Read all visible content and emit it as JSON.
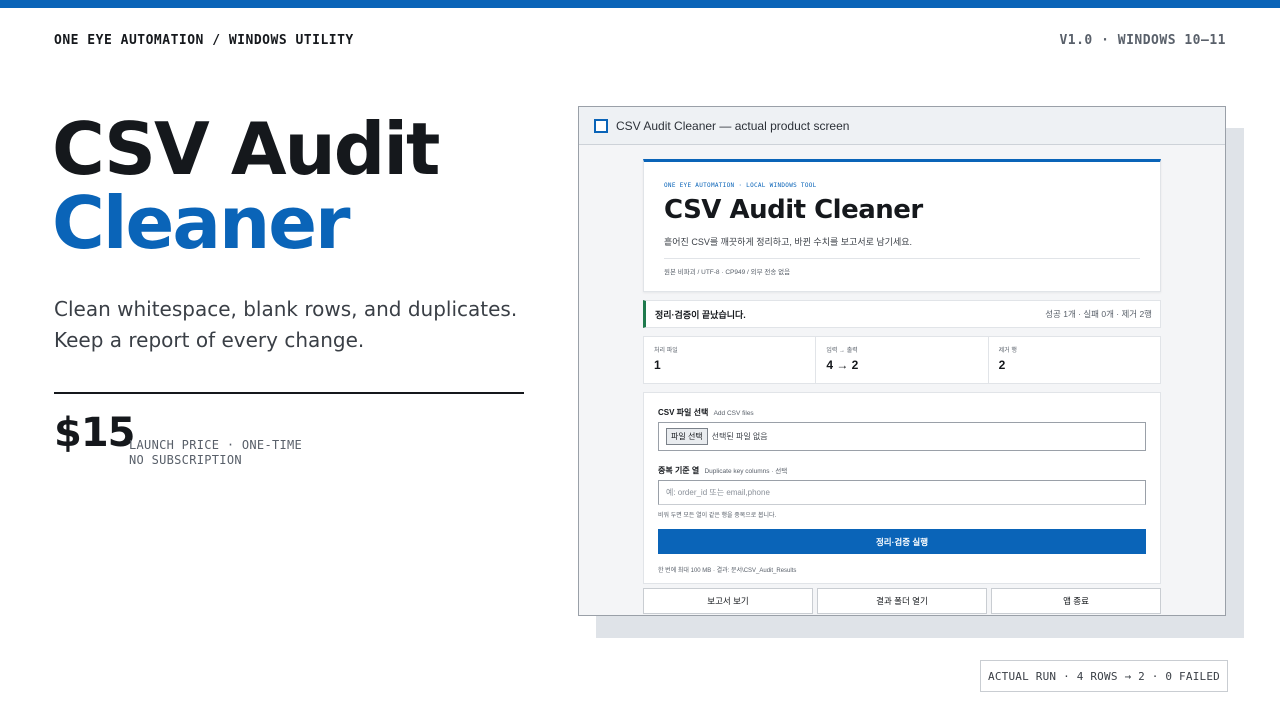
{
  "colors": {
    "accent": "#0a64b8",
    "success": "#1f7a4d",
    "text": "#15181c",
    "muted": "#59606a"
  },
  "header": {
    "left": "ONE EYE AUTOMATION / WINDOWS UTILITY",
    "right": "V1.0 · WINDOWS 10–11"
  },
  "hero": {
    "title_line1": "CSV Audit",
    "title_line2": "Cleaner",
    "subtitle": "Clean whitespace, blank rows, and duplicates. Keep a report of every change.",
    "price": "$15",
    "price_note_line1": "LAUNCH PRICE · ONE-TIME",
    "price_note_line2": "NO SUBSCRIPTION"
  },
  "window": {
    "checkbox_icon": "checkbox-icon",
    "title": "CSV Audit Cleaner — actual product screen",
    "app": {
      "kicker": "ONE EYE AUTOMATION · LOCAL WINDOWS TOOL",
      "title": "CSV Audit Cleaner",
      "description": "흩어진 CSV를 깨끗하게 정리하고, 바뀐 수치를 보고서로 남기세요.",
      "tags": "원본 비파괴 / UTF-8 · CP949 / 외부 전송 없음",
      "status_main": "정리·검증이 끝났습니다.",
      "status_side": "성공 1개 · 실패 0개 · 제거 2행",
      "stats": [
        {
          "label": "처리 파일",
          "value": "1"
        },
        {
          "label": "입력 → 출력",
          "value": "4 → 2"
        },
        {
          "label": "제거 행",
          "value": "2"
        }
      ],
      "form": {
        "file_label": "CSV 파일 선택",
        "file_hint": "Add CSV files",
        "file_button": "파일 선택",
        "file_value": "선택된 파일 없음",
        "dup_label": "중복 기준 열",
        "dup_hint": "Duplicate key columns · 선택",
        "dup_placeholder": "예: order_id 또는 email,phone",
        "dup_help": "비워 두면 모든 열이 같은 행을 중복으로 봅니다.",
        "run_button": "정리·검증 실행",
        "footer": "한 번에 최대 100 MB · 결과: 문서\\CSV_Audit_Results"
      },
      "actions": [
        "보고서 보기",
        "결과 폴더 열기",
        "앱 종료"
      ]
    }
  },
  "badge": "ACTUAL RUN · 4 ROWS → 2 · 0 FAILED"
}
